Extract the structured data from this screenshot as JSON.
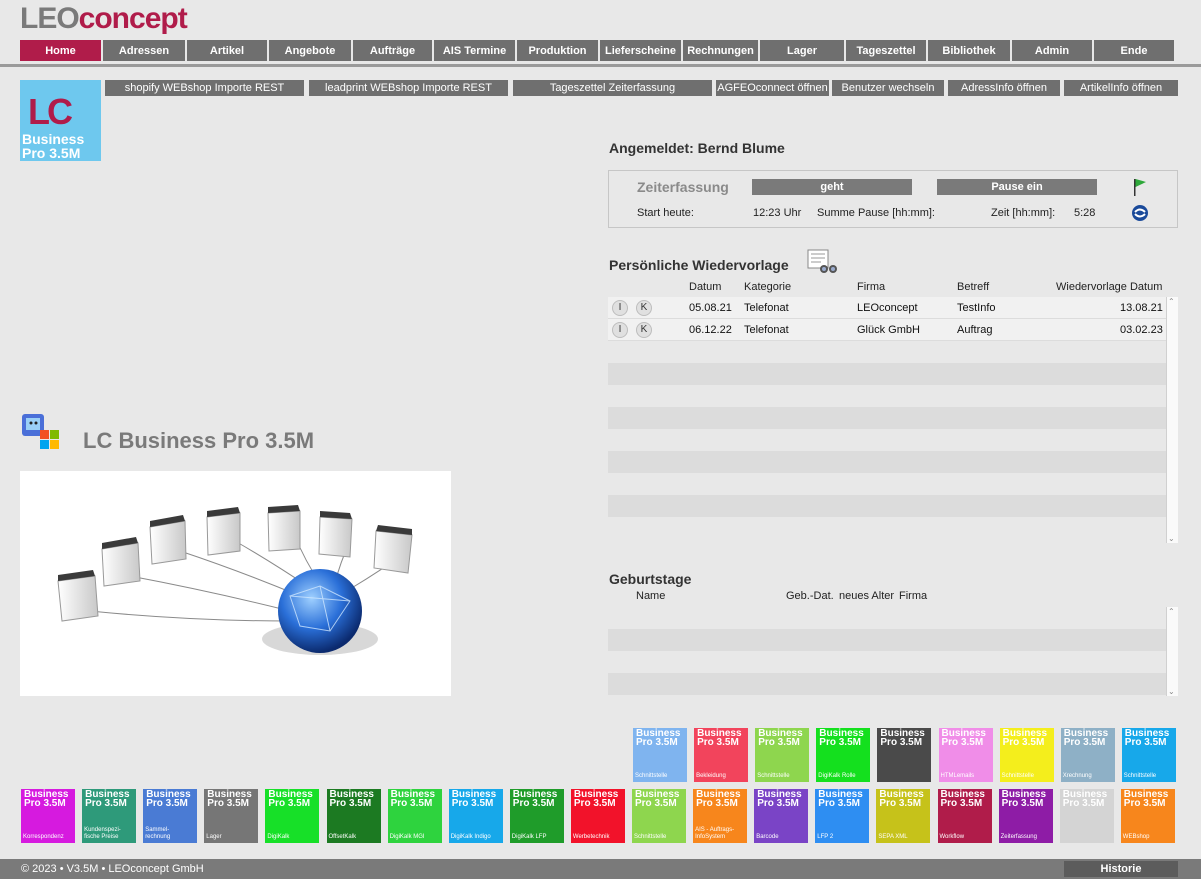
{
  "brand": {
    "leo": "LEO",
    "concept": "concept"
  },
  "nav": [
    {
      "label": "Home",
      "active": true
    },
    {
      "label": "Adressen"
    },
    {
      "label": "Artikel"
    },
    {
      "label": "Angebote"
    },
    {
      "label": "Aufträge"
    },
    {
      "label": "AIS Termine"
    },
    {
      "label": "Produktion"
    },
    {
      "label": "Lieferscheine"
    },
    {
      "label": "Rechnungen"
    },
    {
      "label": "Lager"
    },
    {
      "label": "Tageszettel"
    },
    {
      "label": "Bibliothek"
    },
    {
      "label": "Admin"
    },
    {
      "label": "Ende"
    }
  ],
  "lc_tile": {
    "lc": "LC",
    "business": "Business",
    "pro": "Pro 3.5M"
  },
  "quick_buttons": [
    "shopify WEBshop Importe REST",
    "leadprint WEBshop Importe REST",
    "Tageszettel Zeiterfassung",
    "AGFEOconnect öffnen",
    "Benutzer wechseln",
    "AdressInfo öffnen",
    "ArtikelInfo öffnen"
  ],
  "logged_in": "Angemeldet: Bernd Blume",
  "zeit": {
    "title": "Zeiterfassung",
    "geht": "geht",
    "pause": "Pause ein",
    "start_label": "Start heute:",
    "start_value": "12:23 Uhr",
    "summe_label": "Summe Pause [hh:mm]:",
    "zeit_label": "Zeit [hh:mm]:",
    "zeit_value": "5:28"
  },
  "wiedervorlage": {
    "title": "Persönliche Wiedervorlage",
    "headers": {
      "datum": "Datum",
      "kategorie": "Kategorie",
      "firma": "Firma",
      "betreff": "Betreff",
      "wv_datum": "Wiedervorlage Datum"
    },
    "rows": [
      {
        "i": "I",
        "k": "K",
        "datum": "05.08.21",
        "kategorie": "Telefonat",
        "firma": "LEOconcept",
        "betreff": "TestInfo",
        "wv_datum": "13.08.21"
      },
      {
        "i": "I",
        "k": "K",
        "datum": "06.12.22",
        "kategorie": "Telefonat",
        "firma": "Glück GmbH",
        "betreff": "Auftrag",
        "wv_datum": "03.02.23"
      }
    ]
  },
  "geburtstage": {
    "title": "Geburtstage",
    "headers": {
      "name": "Name",
      "geb": "Geb.-Dat.",
      "alter": "neues Alter",
      "firma": "Firma"
    }
  },
  "product_title": "LC Business Pro 3.5M",
  "tiles_top": [
    {
      "color": "#7fb4ef",
      "l1": "Business",
      "l2": "Pro 3.5M",
      "label": "Schnittstelle"
    },
    {
      "color": "#f2445c",
      "l1": "Business",
      "l2": "Pro 3.5M",
      "label": "Bekleidung"
    },
    {
      "color": "#8ed64e",
      "l1": "Business",
      "l2": "Pro 3.5M",
      "label": "Schnittstelle"
    },
    {
      "color": "#14e01e",
      "l1": "Business",
      "l2": "Pro 3.5M",
      "label": "DigiKalk Rolle"
    },
    {
      "color": "#4a4a4a",
      "l1": "Business",
      "l2": "Pro 3.5M",
      "label": ""
    },
    {
      "color": "#f08de8",
      "l1": "Business",
      "l2": "Pro 3.5M",
      "label": "HTMLemails"
    },
    {
      "color": "#f4ee1c",
      "l1": "Business",
      "l2": "Pro 3.5M",
      "label": "Schnittstelle"
    },
    {
      "color": "#8eb0c6",
      "l1": "Business",
      "l2": "Pro 3.5M",
      "label": "Xrechnung"
    },
    {
      "color": "#17a8ea",
      "l1": "Business",
      "l2": "Pro 3.5M",
      "label": "Schnittstelle"
    }
  ],
  "tiles_bottom": [
    {
      "color": "#d61adf",
      "l1": "Business",
      "l2": "Pro 3.5M",
      "label": "Korrespondenz"
    },
    {
      "color": "#2e9a7a",
      "l1": "Business",
      "l2": "Pro 3.5M",
      "label": "Kundenspezi-\nfische Preise"
    },
    {
      "color": "#4a7bd4",
      "l1": "Business",
      "l2": "Pro 3.5M",
      "label": "Sammel-\nrechnung"
    },
    {
      "color": "#767676",
      "l1": "Business",
      "l2": "Pro 3.5M",
      "label": "Lager"
    },
    {
      "color": "#17e028",
      "l1": "Business",
      "l2": "Pro 3.5M",
      "label": "DigiKalk"
    },
    {
      "color": "#1c7a22",
      "l1": "Business",
      "l2": "Pro 3.5M",
      "label": "OffsetKalk"
    },
    {
      "color": "#2ed33e",
      "l1": "Business",
      "l2": "Pro 3.5M",
      "label": "DigiKalk MGI"
    },
    {
      "color": "#17a8ea",
      "l1": "Business",
      "l2": "Pro 3.5M",
      "label": "DigiKalk Indigo"
    },
    {
      "color": "#1f9c2a",
      "l1": "Business",
      "l2": "Pro 3.5M",
      "label": "DigiKalk LFP"
    },
    {
      "color": "#f2122a",
      "l1": "Business",
      "l2": "Pro 3.5M",
      "label": "Werbetechnik"
    },
    {
      "color": "#8ed64e",
      "l1": "Business",
      "l2": "Pro 3.5M",
      "label": "Schnittstelle"
    },
    {
      "color": "#f7861c",
      "l1": "Business",
      "l2": "Pro 3.5M",
      "label": "AIS - Auftrags-\nInfoSystem"
    },
    {
      "color": "#7a44c6",
      "l1": "Business",
      "l2": "Pro 3.5M",
      "label": "Barcode"
    },
    {
      "color": "#2e8ef2",
      "l1": "Business",
      "l2": "Pro 3.5M",
      "label": "LFP 2"
    },
    {
      "color": "#c6c21a",
      "l1": "Business",
      "l2": "Pro 3.5M",
      "label": "SEPA XML"
    },
    {
      "color": "#b01c4a",
      "l1": "Business",
      "l2": "Pro 3.5M",
      "label": "Workflow"
    },
    {
      "color": "#8e1ca6",
      "l1": "Business",
      "l2": "Pro 3.5M",
      "label": "Zeiterfassung"
    },
    {
      "color": "#d4d4d4",
      "l1": "Business",
      "l2": "Pro 3.5M",
      "label": ""
    },
    {
      "color": "#f7861c",
      "l1": "Business",
      "l2": "Pro 3.5M",
      "label": "WEBshop"
    }
  ],
  "footer": {
    "text": "© 2023 • V3.5M • LEOconcept GmbH",
    "historie": "Historie"
  }
}
